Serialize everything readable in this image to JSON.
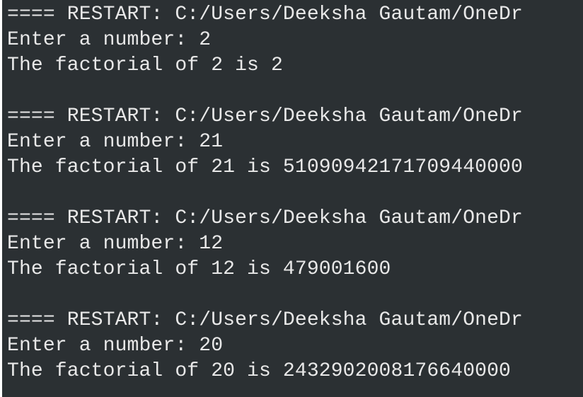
{
  "shell": {
    "lines": [
      "==== RESTART: C:/Users/Deeksha Gautam/OneDr",
      "Enter a number: 2",
      "The factorial of 2 is 2",
      "",
      "==== RESTART: C:/Users/Deeksha Gautam/OneDr",
      "Enter a number: 21",
      "The factorial of 21 is 51090942171709440000",
      "",
      "==== RESTART: C:/Users/Deeksha Gautam/OneDr",
      "Enter a number: 12",
      "The factorial of 12 is 479001600",
      "",
      "==== RESTART: C:/Users/Deeksha Gautam/OneDr",
      "Enter a number: 20",
      "The factorial of 20 is 2432902008176640000"
    ]
  },
  "colors": {
    "background": "#2b3033",
    "text": "#e8e8e8",
    "border": "#ffffff"
  }
}
